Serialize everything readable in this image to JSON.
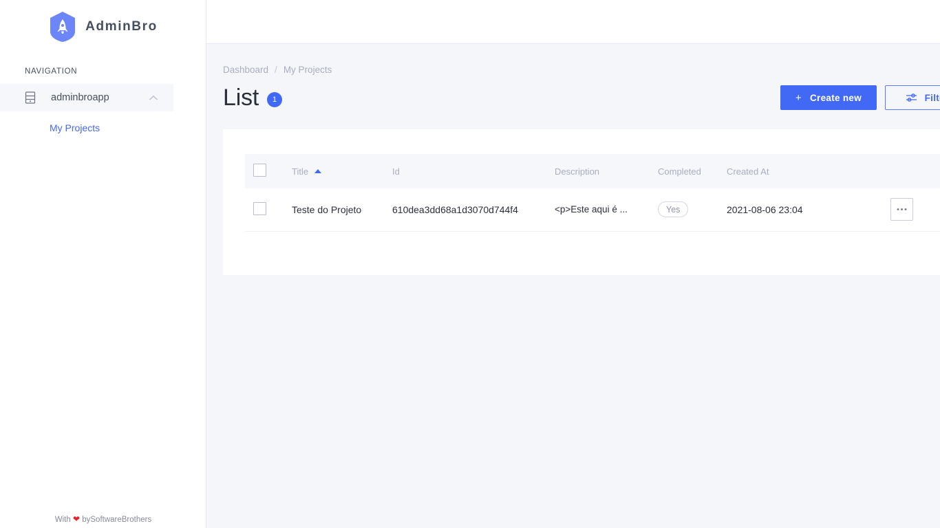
{
  "brand": {
    "name": "AdminBro",
    "logo_icon": "rocket-hexagon-icon",
    "accent_color": "#4268F6"
  },
  "sidebar": {
    "section_label": "NAVIGATION",
    "resource": {
      "label": "adminbroapp",
      "icon": "server-rack-icon",
      "toggle_icon": "chevron-up-icon"
    },
    "sub_items": [
      {
        "label": "My Projects"
      }
    ],
    "footer": {
      "prefix": "With",
      "heart": "❤",
      "suffix": "bySoftwareBrothers"
    }
  },
  "breadcrumb": {
    "items": [
      "Dashboard",
      "My Projects"
    ],
    "separator": "/"
  },
  "header": {
    "title": "List",
    "count": "1",
    "create_button": {
      "label": "Create new",
      "icon": "plus-icon"
    },
    "filter_button": {
      "label": "Filter",
      "icon": "filter-sliders-icon"
    }
  },
  "table": {
    "columns": [
      {
        "key": "title",
        "label": "Title",
        "sorted": "asc"
      },
      {
        "key": "id",
        "label": "Id"
      },
      {
        "key": "description",
        "label": "Description"
      },
      {
        "key": "completed",
        "label": "Completed"
      },
      {
        "key": "created_at",
        "label": "Created At"
      }
    ],
    "rows": [
      {
        "title": "Teste do Projeto",
        "id": "610dea3dd68a1d3070d744f4",
        "description": "<p>Este aqui é ...",
        "completed": "Yes",
        "created_at": "2021-08-06 23:04",
        "actions_label": "···"
      }
    ]
  }
}
